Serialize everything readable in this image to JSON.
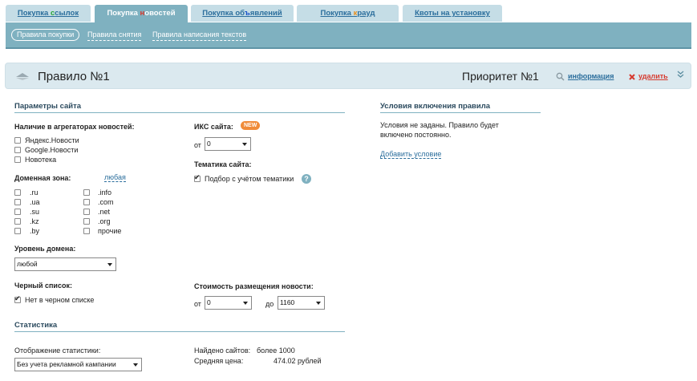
{
  "tabs": {
    "t1": {
      "a": "Покупка ",
      "b": "с",
      "c": "сылок"
    },
    "t2": {
      "a": "Покупка ",
      "b": "н",
      "c": "овостей"
    },
    "t3": {
      "a": "Покупка об",
      "b": "ъ",
      "c": "явлений"
    },
    "t4": {
      "a": "Покупка ",
      "b": "к",
      "c": "рауд"
    },
    "t5": "Квоты на установку"
  },
  "subtabs": [
    "Правила покупки",
    "Правила снятия",
    "Правила написания текстов"
  ],
  "rule": {
    "title": "Правило №1",
    "priority": "Приоритет №1",
    "info_link": "информация",
    "delete_link": "удалить"
  },
  "params": {
    "section_title": "Параметры сайта",
    "aggregators_label": "Наличие в агрегаторах новостей:",
    "aggregators": [
      "Яндекс.Новости",
      "Google.Новости",
      "Новотека"
    ],
    "domain_zone_label": "Доменная зона:",
    "domain_zone_any": "любая",
    "zones_col1": [
      ".ru",
      ".ua",
      ".su",
      ".kz",
      ".by"
    ],
    "zones_col2": [
      ".info",
      ".com",
      ".net",
      ".org",
      "прочие"
    ],
    "domain_level_label": "Уровень домена:",
    "domain_level_value": "любой",
    "blacklist_label": "Черный список:",
    "blacklist_option": "Нет в черном списке",
    "iks_label": "ИКС сайта:",
    "new_badge": "NEW",
    "from_label": "от",
    "iks_from_value": "0",
    "theme_label": "Тематика сайта:",
    "theme_option": "Подбор с учётом тематики",
    "help_glyph": "?",
    "cost_label": "Стоимость размещения новости:",
    "cost_from_label": "от",
    "cost_from_value": "0",
    "cost_to_label": "до",
    "cost_to_value": "1160"
  },
  "conditions": {
    "section_title": "Условия включения правила",
    "text_line1": "Условия не заданы. Правило будет",
    "text_line2": "включено постоянно.",
    "add_link": "Добавить условие"
  },
  "stats": {
    "section_title": "Статистика",
    "display_label": "Отображение статистики:",
    "display_value": "Без учета рекламной кампании",
    "found_label": "Найдено сайтов:",
    "found_value": "более 1000",
    "avg_label": "Средняя цена:",
    "avg_value": "474.02 рублей"
  },
  "colors": {
    "accent": "#7fb1c0",
    "link": "#2b6e9c",
    "delete": "#d63b2f",
    "badge": "#f08c3a"
  }
}
